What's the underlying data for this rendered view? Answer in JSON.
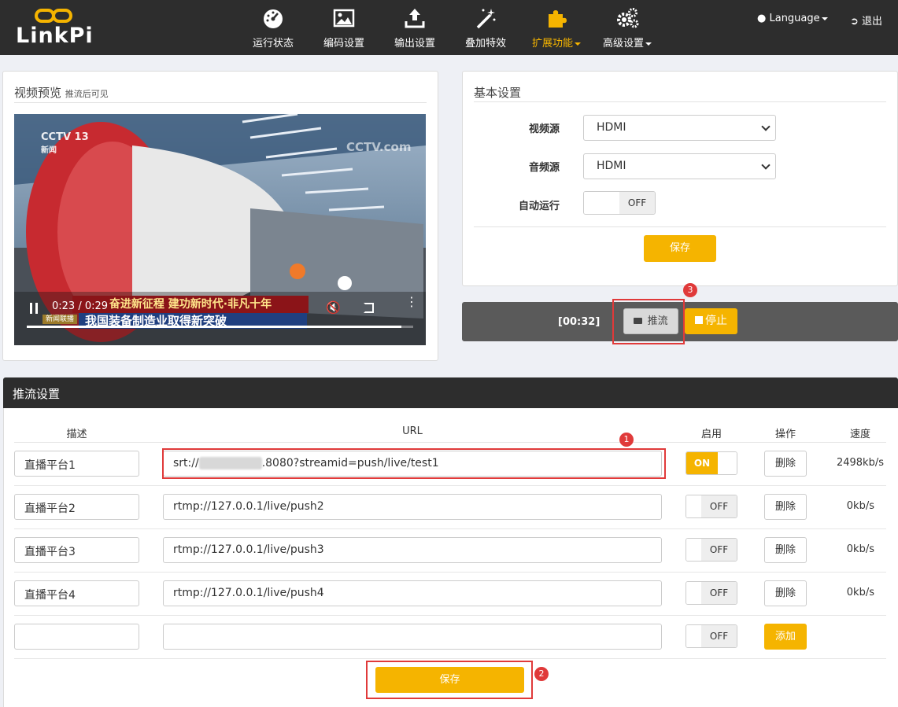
{
  "brand": {
    "name": "LinkPi"
  },
  "nav": {
    "items": [
      {
        "label": "运行状态",
        "icon": "dashboard-icon"
      },
      {
        "label": "编码设置",
        "icon": "image-icon"
      },
      {
        "label": "输出设置",
        "icon": "upload-icon"
      },
      {
        "label": "叠加特效",
        "icon": "magic-wand-icon"
      },
      {
        "label": "扩展功能",
        "icon": "puzzle-icon",
        "active": true,
        "dropdown": true
      },
      {
        "label": "高级设置",
        "icon": "gears-icon",
        "dropdown": true
      }
    ],
    "language": "Language",
    "logout": "退出"
  },
  "preview": {
    "title": "视频预览",
    "subtitle": "推流后可见",
    "video": {
      "time": "0:23 / 0:29",
      "progress": 0.97,
      "channel": "CCTV 13",
      "channel_sub": "新闻",
      "watermark": "CCTV.com",
      "caption_top": "奋进新征程 建功新时代·非凡十年",
      "caption_bottom": "我国装备制造业取得新突破",
      "caption_tag": "新闻联播"
    }
  },
  "basic": {
    "title": "基本设置",
    "video_source_label": "视频源",
    "video_source_value": "HDMI",
    "audio_source_label": "音频源",
    "audio_source_value": "HDMI",
    "auto_run_label": "自动运行",
    "auto_run_value": "OFF",
    "save_label": "保存"
  },
  "stream_control": {
    "elapsed": "[00:32]",
    "push_label": "推流",
    "stop_label": "停止"
  },
  "push_settings": {
    "title": "推流设置",
    "columns": {
      "desc": "描述",
      "url": "URL",
      "enable": "启用",
      "action": "操作",
      "speed": "速度"
    },
    "rows": [
      {
        "desc": "直播平台1",
        "url_prefix": "srt://",
        "url_suffix": ".8080?streamid=push/live/test1",
        "enabled": "ON",
        "action": "删除",
        "speed": "2498kb/s"
      },
      {
        "desc": "直播平台2",
        "url": "rtmp://127.0.0.1/live/push2",
        "enabled": "OFF",
        "action": "删除",
        "speed": "0kb/s"
      },
      {
        "desc": "直播平台3",
        "url": "rtmp://127.0.0.1/live/push3",
        "enabled": "OFF",
        "action": "删除",
        "speed": "0kb/s"
      },
      {
        "desc": "直播平台4",
        "url": "rtmp://127.0.0.1/live/push4",
        "enabled": "OFF",
        "action": "删除",
        "speed": "0kb/s"
      }
    ],
    "new_row": {
      "desc": "",
      "url": "",
      "enabled": "OFF",
      "add_label": "添加"
    },
    "save_label": "保存"
  },
  "annotations": {
    "step1": "1",
    "step2": "2",
    "step3": "3"
  },
  "colors": {
    "accent": "#f5b400",
    "navbar": "#2d2d2d",
    "highlight": "#e03a3a"
  }
}
